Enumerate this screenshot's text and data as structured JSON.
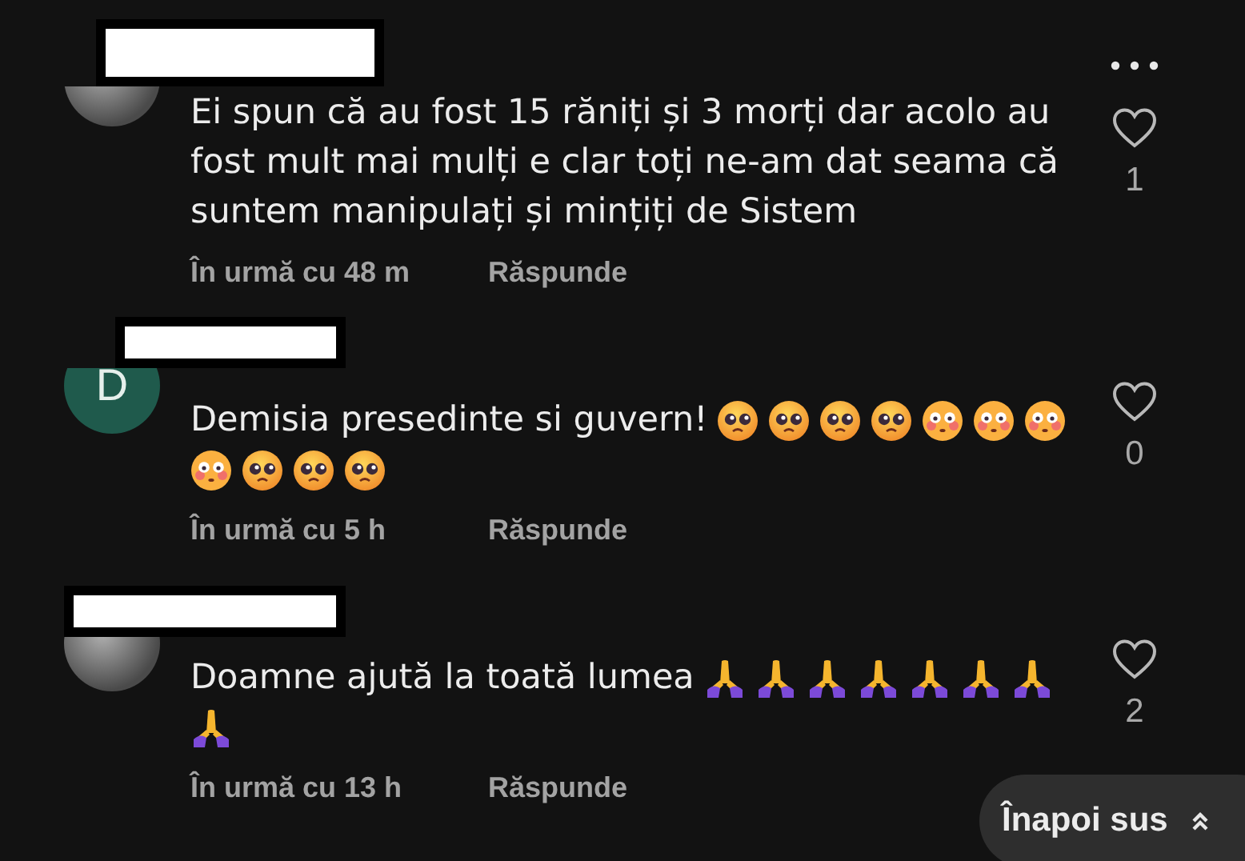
{
  "comments": [
    {
      "avatar": {
        "kind": "photo"
      },
      "name_redacted": true,
      "text": "Ei spun că au fost 15 răniți și 3 morți dar acolo au fost mult mai mulți e clar toți ne-am dat seama că suntem manipulați și mințiți de Sistem",
      "time": "În urmă cu 48 m",
      "reply": "Răspunde",
      "more_button": true,
      "likes": "1"
    },
    {
      "avatar": {
        "kind": "letter",
        "letter": "D"
      },
      "name_redacted": true,
      "text": "Demisia presedinte si guvern!",
      "emojis": [
        {
          "kind": "pleading"
        },
        {
          "kind": "pleading"
        },
        {
          "kind": "pleading"
        },
        {
          "kind": "pleading"
        },
        {
          "kind": "flushed"
        },
        {
          "kind": "flushed"
        },
        {
          "kind": "flushed"
        },
        {
          "kind": "flushed"
        },
        {
          "kind": "pleading"
        },
        {
          "kind": "pleading"
        },
        {
          "kind": "pleading"
        }
      ],
      "time": "În urmă cu 5 h",
      "reply": "Răspunde",
      "more_button": false,
      "likes": "0"
    },
    {
      "avatar": {
        "kind": "photo"
      },
      "name_redacted": true,
      "text": "Doamne ajută la toată lumea",
      "emojis": [
        {
          "kind": "praying"
        },
        {
          "kind": "praying"
        },
        {
          "kind": "praying"
        },
        {
          "kind": "praying"
        },
        {
          "kind": "praying"
        },
        {
          "kind": "praying"
        },
        {
          "kind": "praying"
        },
        {
          "kind": "praying"
        }
      ],
      "time": "În urmă cu 13 h",
      "reply": "Răspunde",
      "more_button": false,
      "likes": "2"
    }
  ],
  "back_to_top": {
    "label": "Înapoi sus"
  }
}
